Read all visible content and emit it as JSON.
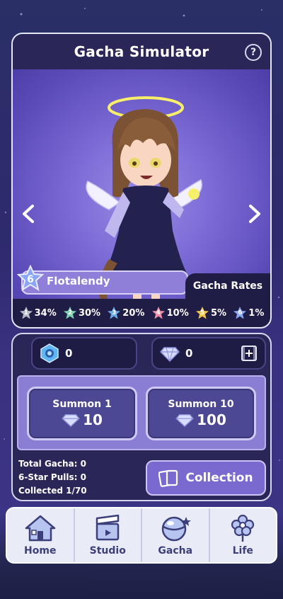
{
  "header": {
    "title": "Gacha Simulator",
    "help_icon": "question-icon"
  },
  "character": {
    "name": "Flotalendy",
    "rank": "6"
  },
  "gacha_rates": {
    "label": "Gacha Rates",
    "rates": [
      {
        "star": "1",
        "value": "34%",
        "color": "#b9bccb"
      },
      {
        "star": "2",
        "value": "30%",
        "color": "#7fd2b0"
      },
      {
        "star": "3",
        "value": "20%",
        "color": "#6aa9e8"
      },
      {
        "star": "4",
        "value": "10%",
        "color": "#ee8aa8"
      },
      {
        "star": "5",
        "value": "5%",
        "color": "#f1c64a"
      },
      {
        "star": "6",
        "value": "1%",
        "color": "#8aa6f4"
      }
    ]
  },
  "resources": {
    "tickets": "0",
    "gems": "0"
  },
  "summon": {
    "one": {
      "label": "Summon 1",
      "cost": "10"
    },
    "ten": {
      "label": "Summon 10",
      "cost": "100"
    }
  },
  "stats": {
    "total_gacha": "Total Gacha: 0",
    "six_star": "6-Star Pulls: 0",
    "collected": "Collected 1/70"
  },
  "collection_button": "Collection",
  "nav": {
    "home": "Home",
    "studio": "Studio",
    "gacha": "Gacha",
    "life": "Life"
  },
  "colors": {
    "card_header": "#2a2658",
    "accent": "#7a6ad0",
    "nav_text": "#3c3f7a"
  }
}
